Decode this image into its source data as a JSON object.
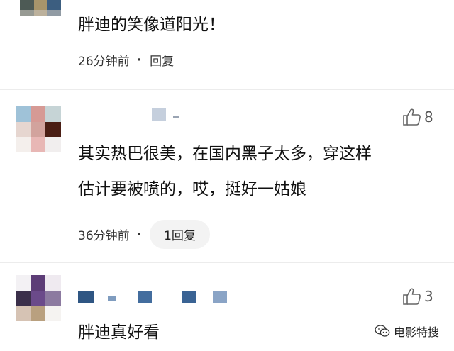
{
  "comments": [
    {
      "text": "胖迪的笑像道阳光！",
      "time": "26分钟前",
      "separator": "·",
      "reply_label": "回复"
    },
    {
      "text_line1": "其实热巴很美，在国内黑子太多，穿这样",
      "text_line2": "估计要被喷的，哎，挺好一姑娘",
      "time": "36分钟前",
      "separator": "·",
      "reply_label": "1回复",
      "likes": "8"
    },
    {
      "text": "胖迪真好看",
      "likes": "3"
    }
  ],
  "watermark": {
    "label": "电影特搜",
    "icon": "wechat-icon"
  },
  "colors": {
    "text": "#111111",
    "meta": "#333333",
    "pill_bg": "#f3f3f3",
    "like": "#555555"
  }
}
